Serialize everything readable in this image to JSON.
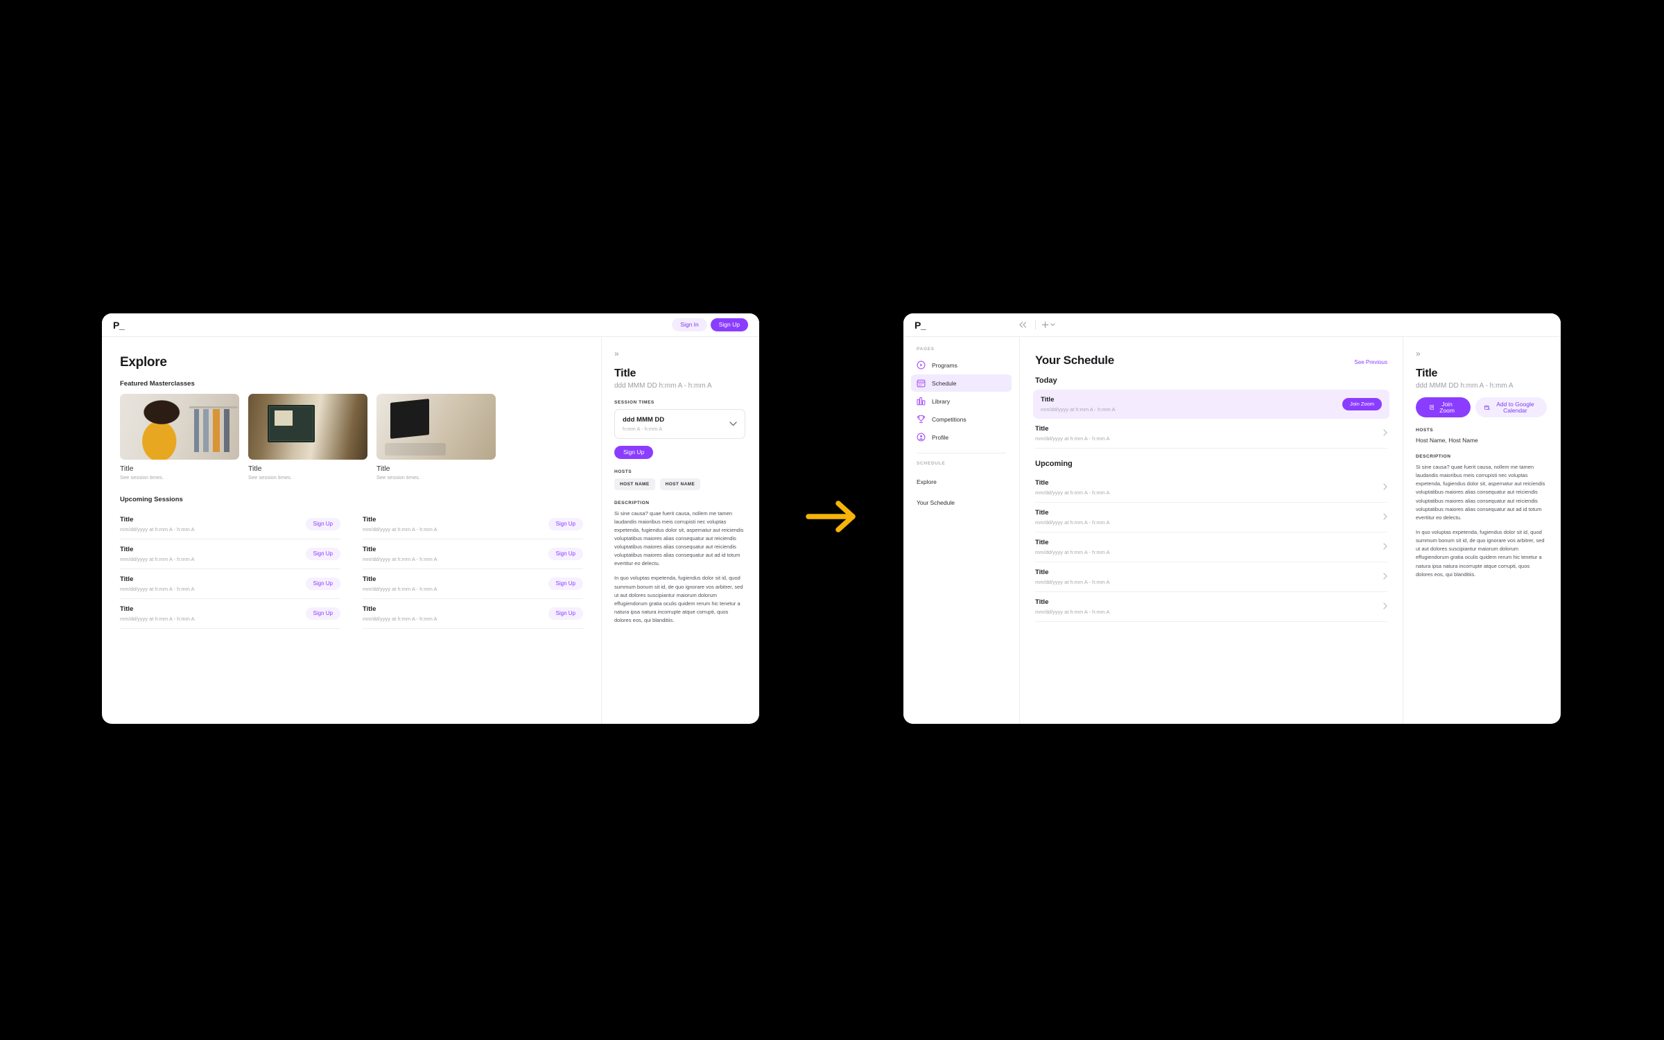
{
  "brand": {
    "logo": "P_",
    "accent": "#8b3dff",
    "accent_soft": "#f4edff",
    "arrow_color": "#f6b40a"
  },
  "explore_window": {
    "topbar": {
      "sign_in": "Sign In",
      "sign_up": "Sign Up"
    },
    "page_title": "Explore",
    "featured": {
      "label": "Featured Masterclasses",
      "cards": [
        {
          "title": "Title",
          "subtitle": "See session times."
        },
        {
          "title": "Title",
          "subtitle": "See session times."
        },
        {
          "title": "Title",
          "subtitle": "See session times."
        }
      ]
    },
    "upcoming": {
      "label": "Upcoming Sessions",
      "action_label": "Sign Up",
      "sessions": [
        {
          "title": "Title",
          "time": "mm/dd/yyyy at h:mm A - h:mm A"
        },
        {
          "title": "Title",
          "time": "mm/dd/yyyy at h:mm A - h:mm A"
        },
        {
          "title": "Title",
          "time": "mm/dd/yyyy at h:mm A - h:mm A"
        },
        {
          "title": "Title",
          "time": "mm/dd/yyyy at h:mm A - h:mm A"
        },
        {
          "title": "Title",
          "time": "mm/dd/yyyy at h:mm A - h:mm A"
        },
        {
          "title": "Title",
          "time": "mm/dd/yyyy at h:mm A - h:mm A"
        },
        {
          "title": "Title",
          "time": "mm/dd/yyyy at h:mm A - h:mm A"
        },
        {
          "title": "Title",
          "time": "mm/dd/yyyy at h:mm A - h:mm A"
        }
      ]
    },
    "detail": {
      "title": "Title",
      "subtitle": "ddd MMM DD h:mm A - h:mm A",
      "session_times_label": "SESSION TIMES",
      "select_value": "ddd MMM DD",
      "select_sub": "h:mm A - h:mm A",
      "sign_up_label": "Sign Up",
      "hosts_label": "HOSTS",
      "host_chips": [
        "HOST NAME",
        "HOST NAME"
      ],
      "description_label": "DESCRIPTION",
      "description_paragraphs": [
        "Si sine causa? quae fuerit causa, nollem me tamen laudandis maioribus meis corrupisti nec voluptas expetenda, fugiendus dolor sit, aspernatur aut reiciendis voluptatibus maiores alias consequatur aut reiciendis voluptatibus maiores alias consequatur aut reiciendis voluptatibus maiores alias consequatur aut ad id totum evertitur eo delectu.",
        "In quo voluptas expetenda, fugiendus dolor sit id, quod summum bonum sit id, de quo ignorare vos arbitrer, sed ut aut dolores suscipiantur maiorum dolorum effugiendorum gratia  oculis quidem rerum hic tenetur a natura ipsa natura incorrupte atque corrupti, quos dolores eos, qui blanditiis."
      ]
    }
  },
  "schedule_window": {
    "sidebar": {
      "pages_label": "PAGES",
      "pages": [
        {
          "label": "Programs",
          "icon": "play-circle-icon",
          "state": "default"
        },
        {
          "label": "Schedule",
          "icon": "calendar-icon",
          "state": "active-purple"
        },
        {
          "label": "Library",
          "icon": "library-icon",
          "state": "default"
        },
        {
          "label": "Competitions",
          "icon": "trophy-icon",
          "state": "default"
        },
        {
          "label": "Profile",
          "icon": "person-circle-icon",
          "state": "default"
        }
      ],
      "schedule_label": "SCHEDULE",
      "schedule_items": [
        {
          "label": "Explore",
          "state": "default"
        },
        {
          "label": "Your Schedule",
          "state": "active-gray"
        }
      ]
    },
    "main": {
      "title": "Your Schedule",
      "see_previous": "See Previous",
      "today_label": "Today",
      "today": [
        {
          "title": "Title",
          "time": "mm/dd/yyyy at h:mm A - h:mm A",
          "action": "Join Zoom",
          "highlight": true
        },
        {
          "title": "Title",
          "time": "mm/dd/yyyy at h:mm A - h:mm A",
          "action": "",
          "highlight": false
        }
      ],
      "upcoming_label": "Upcoming",
      "upcoming": [
        {
          "title": "Title",
          "time": "mm/dd/yyyy at h:mm A - h:mm A"
        },
        {
          "title": "Title",
          "time": "mm/dd/yyyy at h:mm A - h:mm A"
        },
        {
          "title": "Title",
          "time": "mm/dd/yyyy at h:mm A - h:mm A"
        },
        {
          "title": "Title",
          "time": "mm/dd/yyyy at h:mm A - h:mm A"
        },
        {
          "title": "Title",
          "time": "mm/dd/yyyy at h:mm A - h:mm A"
        }
      ]
    },
    "detail": {
      "title": "Title",
      "subtitle": "ddd MMM DD h:mm A - h:mm A",
      "join_zoom_label": "Join Zoom",
      "add_calendar_label": "Add to Google Calendar",
      "hosts_label": "HOSTS",
      "hosts_value": "Host Name, Host Name",
      "description_label": "DESCRIPTION",
      "description_paragraphs": [
        "Si sine causa? quae fuerit causa, nollem me tamen laudandis maioribus meis corrupisti nec voluptas expetenda, fugiendus dolor sit, aspernatur aut reiciendis voluptatibus maiores alias consequatur aut reiciendis voluptatibus maiores alias consequatur aut reiciendis voluptatibus maiores alias consequatur aut ad id totum evertitur eo delectu.",
        "In quo voluptas expetenda, fugiendus dolor sit id, quod summum bonum sit id, de quo ignorare vos arbitrer, sed ut aut dolores suscipiantur maiorum dolorum effugiendorum gratia  oculis quidem rerum hic tenetur a natura ipsa natura incorrupte atque corrupti, quos dolores eos, qui blanditiis."
      ]
    }
  }
}
